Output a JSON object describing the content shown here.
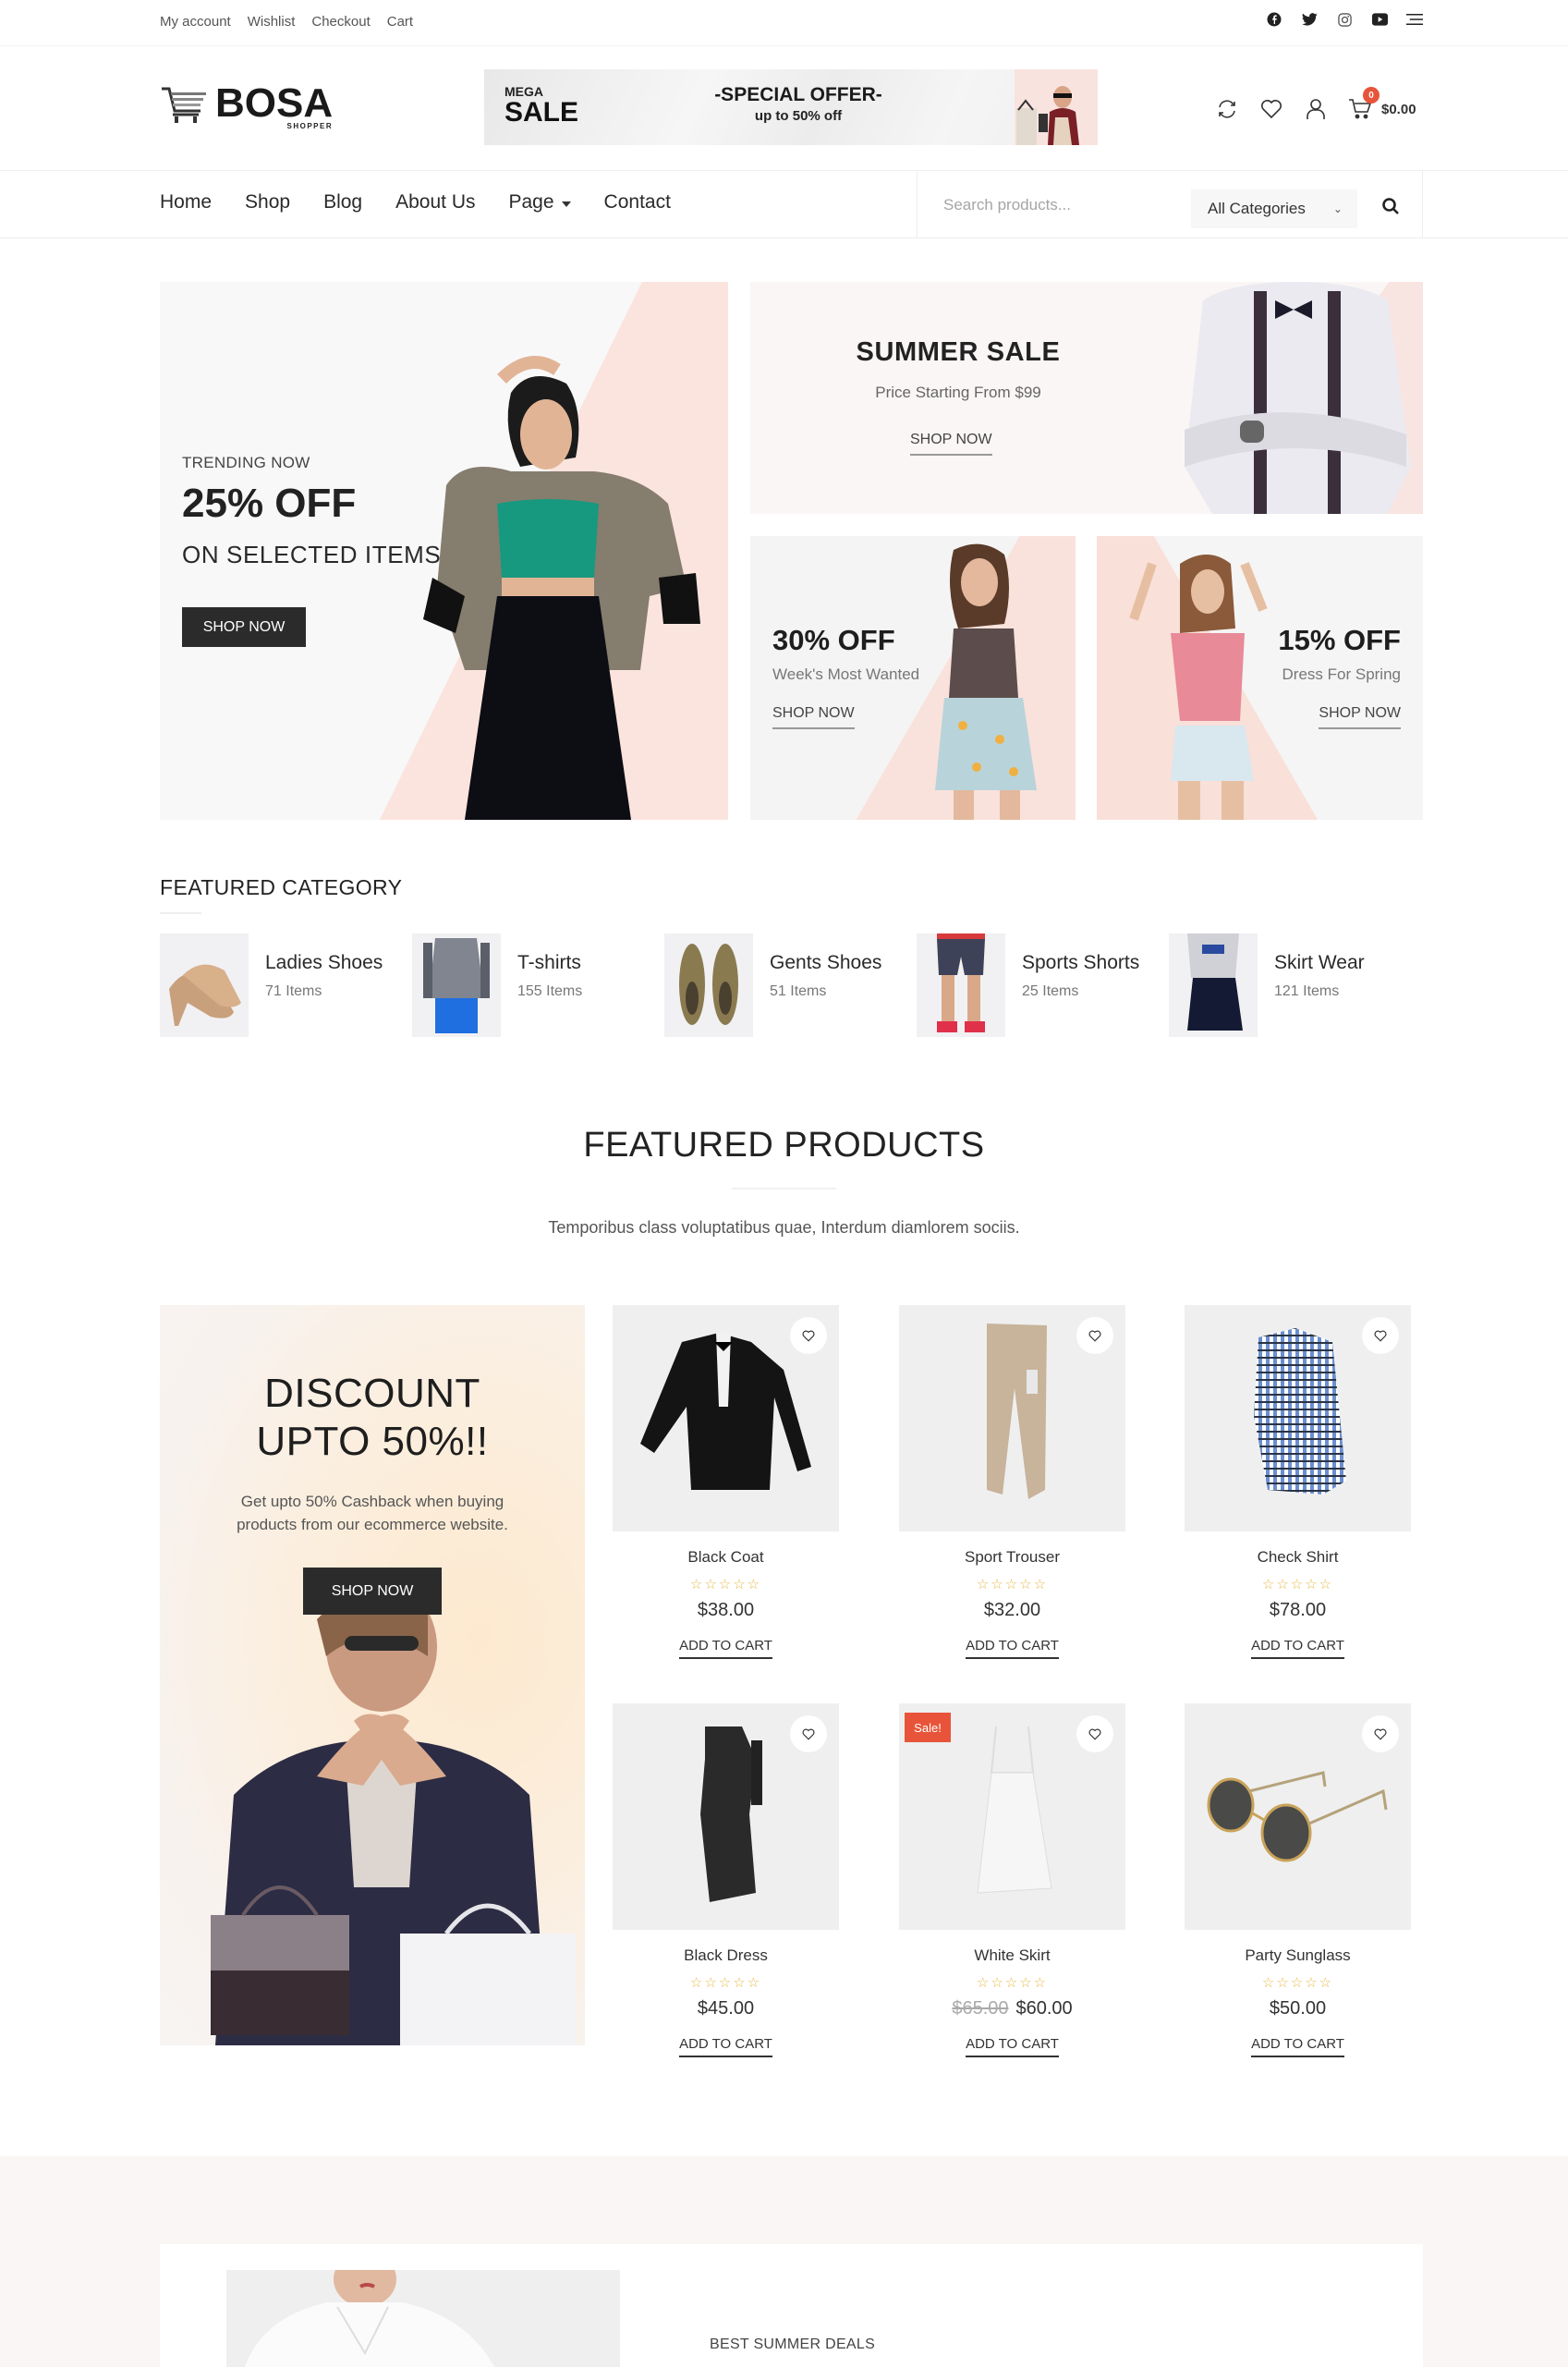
{
  "topbar": {
    "links": [
      "My account",
      "Wishlist",
      "Checkout",
      "Cart"
    ],
    "social_icons": [
      "facebook-icon",
      "twitter-icon",
      "instagram-icon",
      "youtube-icon",
      "menu-icon"
    ]
  },
  "header": {
    "logo": {
      "brand": "BOSA",
      "tagline": "SHOPPER"
    },
    "banner": {
      "kicker": "MEGA",
      "headline": "SALE",
      "offer": "-SPECIAL OFFER-",
      "offer_sub": "up to 50% off"
    },
    "icons": [
      "compare-icon",
      "wishlist-icon",
      "account-icon",
      "cart-icon"
    ],
    "cart_count": "0",
    "cart_total": "$0.00"
  },
  "nav": {
    "items": [
      {
        "label": "Home"
      },
      {
        "label": "Shop"
      },
      {
        "label": "Blog"
      },
      {
        "label": "About Us"
      },
      {
        "label": "Page",
        "has_dropdown": true
      },
      {
        "label": "Contact"
      }
    ],
    "search": {
      "placeholder": "Search products...",
      "category": "All Categories"
    }
  },
  "hero": {
    "main": {
      "kicker": "TRENDING NOW",
      "headline": "25% OFF",
      "subline": "ON SELECTED ITEMS",
      "cta": "SHOP NOW"
    },
    "top": {
      "title": "SUMMER SALE",
      "subtitle": "Price Starting From $99",
      "cta": "SHOP NOW"
    },
    "bottom_left": {
      "headline": "30% OFF",
      "subtitle": "Week's Most Wanted",
      "cta": "SHOP NOW"
    },
    "bottom_right": {
      "headline": "15% OFF",
      "subtitle": "Dress For Spring",
      "cta": "SHOP NOW"
    }
  },
  "featured_category": {
    "title": "FEATURED CATEGORY",
    "items": [
      {
        "name": "Ladies Shoes",
        "count": "71 Items"
      },
      {
        "name": "T-shirts",
        "count": "155 Items"
      },
      {
        "name": "Gents Shoes",
        "count": "51 Items"
      },
      {
        "name": "Sports Shorts",
        "count": "25 Items"
      },
      {
        "name": "Skirt Wear",
        "count": "121 Items"
      }
    ]
  },
  "featured_products": {
    "title": "FEATURED PRODUCTS",
    "subtitle": "Temporibus class voluptatibus quae, Interdum diamlorem sociis.",
    "promo": {
      "headline_1": "DISCOUNT",
      "headline_2": "UPTO 50%!!",
      "text": "Get upto 50% Cashback when buying products from our ecommerce website.",
      "cta": "SHOP NOW"
    },
    "products": [
      {
        "name": "Black Coat",
        "price": "$38.00",
        "old_price": "",
        "sale": false,
        "rating": 0,
        "stars": "☆☆☆☆☆",
        "cta": "ADD TO CART"
      },
      {
        "name": "Sport Trouser",
        "price": "$32.00",
        "old_price": "",
        "sale": false,
        "rating": 0,
        "stars": "☆☆☆☆☆",
        "cta": "ADD TO CART"
      },
      {
        "name": "Check Shirt",
        "price": "$78.00",
        "old_price": "",
        "sale": false,
        "rating": 0,
        "stars": "☆☆☆☆☆",
        "cta": "ADD TO CART"
      },
      {
        "name": "Black Dress",
        "price": "$45.00",
        "old_price": "",
        "sale": false,
        "rating": 0,
        "stars": "☆☆☆☆☆",
        "cta": "ADD TO CART"
      },
      {
        "name": "White Skirt",
        "price": "$60.00",
        "old_price": "$65.00",
        "sale": true,
        "sale_label": "Sale!",
        "rating": 0,
        "stars": "☆☆☆☆☆",
        "cta": "ADD TO CART"
      },
      {
        "name": "Party Sunglass",
        "price": "$50.00",
        "old_price": "",
        "sale": false,
        "rating": 0,
        "stars": "☆☆☆☆☆",
        "cta": "ADD TO CART"
      }
    ]
  },
  "deals": {
    "label": "BEST SUMMER DEALS"
  },
  "colors": {
    "accent": "#e8543a",
    "dark_button": "#2b2b2b",
    "pink_tint": "#fbe4de",
    "star": "#e9b949"
  }
}
